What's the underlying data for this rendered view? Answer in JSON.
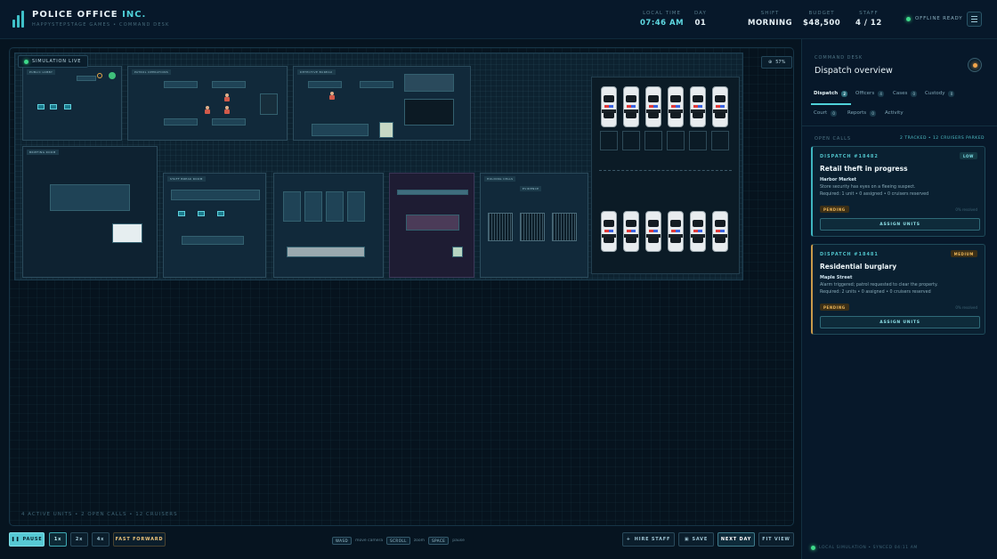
{
  "app": {
    "name_main": "POLICE OFFICE",
    "name_accent": "INC.",
    "subtitle": "HAPPYSTEPSTAGE GAMES  •  COMMAND DESK"
  },
  "stats": {
    "local_time": {
      "label": "LOCAL TIME",
      "value": "07:46 AM"
    },
    "day": {
      "label": "DAY",
      "value": "01"
    },
    "shift": {
      "label": "SHIFT",
      "value": "MORNING"
    },
    "budget": {
      "label": "BUDGET",
      "value": "$48,500"
    },
    "staff": {
      "label": "STAFF",
      "value": "4 / 12"
    }
  },
  "status": {
    "offline": "OFFLINE READY"
  },
  "viewport": {
    "sim_badge": "SIMULATION LIVE",
    "zoom": "57%",
    "status_line": "4 ACTIVE UNITS  •  2 OPEN CALLS  •  12 CRUISERS"
  },
  "rooms": {
    "r1": "PUBLIC LOBBY",
    "r2": "PATROL OPERATIONS",
    "r3": "DETECTIVE BUREAU",
    "r4": "BRIEFING ROOM",
    "r5": "STAFF BREAK ROOM",
    "r6": "HOLDING CELLS",
    "r7": "EVIDENCE"
  },
  "controls": {
    "pause": "PAUSE",
    "speed1": "1x",
    "speed2": "2x",
    "speed4": "4x",
    "fast_forward": "FAST FORWARD",
    "hire_staff": "HIRE STAFF",
    "save": "SAVE",
    "next_day": "NEXT DAY",
    "fit_view": "FIT VIEW"
  },
  "hints": {
    "k1": "WASD",
    "t1": "move camera",
    "k2": "SCROLL",
    "t2": "zoom",
    "k3": "SPACE",
    "t3": "pause"
  },
  "panel": {
    "eyebrow": "COMMAND DESK",
    "title": "Dispatch overview",
    "tabs": [
      {
        "label": "Dispatch",
        "count": "2"
      },
      {
        "label": "Officers",
        "count": "4"
      },
      {
        "label": "Cases",
        "count": "0"
      },
      {
        "label": "Custody",
        "count": "0"
      },
      {
        "label": "Court",
        "count": "0"
      },
      {
        "label": "Reports",
        "count": "0"
      },
      {
        "label": "Activity",
        "count": ""
      }
    ],
    "section": "OPEN CALLS",
    "section_meta": "2 TRACKED  •  12 CRUISERS PARKED",
    "calls": [
      {
        "id": "DISPATCH #18482",
        "priority": "LOW",
        "title": "Retail theft in progress",
        "location": "Harbor Market",
        "desc": "Store security has eyes on a fleeing suspect.",
        "req": "Required: 1 unit  •  0 assigned  •  0 cruisers reserved",
        "status": "PENDING",
        "elapsed": "0% resolved",
        "action": "ASSIGN UNITS"
      },
      {
        "id": "DISPATCH #18481",
        "priority": "MEDIUM",
        "title": "Residential burglary",
        "location": "Maple Street",
        "desc": "Alarm triggered; patrol requested to clear the property.",
        "req": "Required: 2 units  •  0 assigned  •  0 cruisers reserved",
        "status": "PENDING",
        "elapsed": "0% resolved",
        "action": "ASSIGN UNITS"
      }
    ],
    "footer": "LOCAL SIMULATION  •  SYNCED 04:11 AM"
  },
  "colors": {
    "accent": "#4fd1d9",
    "background": "#061420",
    "panel": "#07182a",
    "warning": "#f0b95a"
  }
}
